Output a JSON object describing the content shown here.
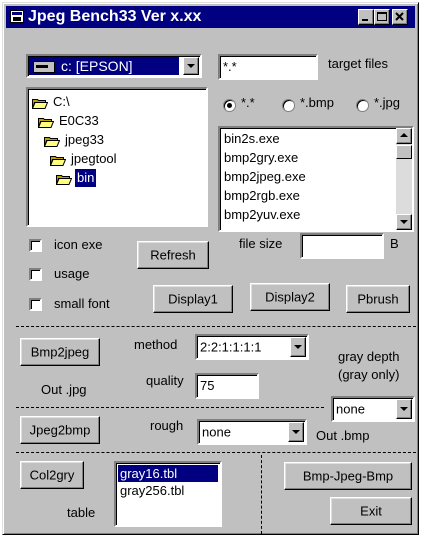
{
  "window": {
    "title": "Jpeg Bench33 Ver x.xx"
  },
  "drive": {
    "selected": "c: [EPSON]"
  },
  "directory_tree": [
    {
      "label": "C:\\",
      "indent": 0,
      "selected": false
    },
    {
      "label": "E0C33",
      "indent": 1,
      "selected": false
    },
    {
      "label": "jpeg33",
      "indent": 2,
      "selected": false
    },
    {
      "label": "jpegtool",
      "indent": 3,
      "selected": false
    },
    {
      "label": "bin",
      "indent": 4,
      "selected": true
    }
  ],
  "target": {
    "value": "*.*",
    "label": "target files"
  },
  "filter_radios": [
    {
      "label": "*.*",
      "checked": true
    },
    {
      "label": "*.bmp",
      "checked": false
    },
    {
      "label": "*.jpg",
      "checked": false
    }
  ],
  "file_list": [
    "bin2s.exe",
    "bmp2gry.exe",
    "bmp2jpeg.exe",
    "bmp2rgb.exe",
    "bmp2yuv.exe"
  ],
  "options": {
    "icon_exe": "icon exe",
    "usage": "usage",
    "small_font": "small font"
  },
  "refresh_label": "Refresh",
  "file_size": {
    "label": "file size",
    "value": "",
    "unit": "B"
  },
  "display_buttons": {
    "display1": "Display1",
    "display2": "Display2",
    "pbrush": "Pbrush"
  },
  "bmp2jpeg": {
    "button": "Bmp2jpeg",
    "method_label": "method",
    "method_value": "2:2:1:1:1:1",
    "out_label": "Out .jpg",
    "quality_label": "quality",
    "quality_value": "75"
  },
  "gray_depth": {
    "label1": "gray depth",
    "label2": "(gray only)",
    "value": "none"
  },
  "jpeg2bmp": {
    "button": "Jpeg2bmp",
    "rough_label": "rough",
    "rough_value": "none",
    "out_label": "Out .bmp"
  },
  "col2gry": {
    "button": "Col2gry",
    "table_label": "table",
    "tables": [
      "gray16.tbl",
      "gray256.tbl"
    ]
  },
  "bmp_jpeg_bmp_label": "Bmp-Jpeg-Bmp",
  "exit_label": "Exit"
}
